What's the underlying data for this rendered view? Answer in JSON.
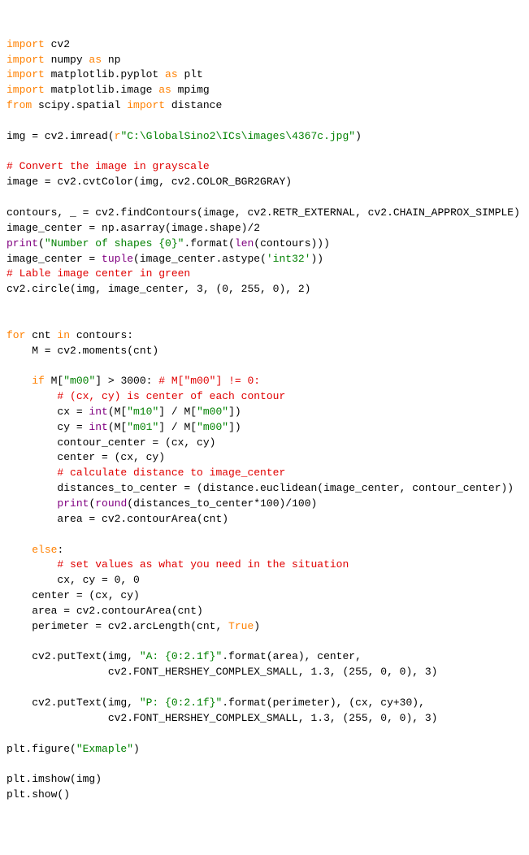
{
  "code": {
    "imports": [
      {
        "keyword": "import",
        "module": " cv2"
      },
      {
        "keyword": "import",
        "module": " numpy ",
        "as": "as",
        "alias": " np"
      },
      {
        "keyword": "import",
        "module": " matplotlib.pyplot ",
        "as": "as",
        "alias": " plt"
      },
      {
        "keyword": "import",
        "module": " matplotlib.image ",
        "as": "as",
        "alias": " mpimg"
      },
      {
        "keyword": "from",
        "module": " scipy.spatial ",
        "import": "import",
        "name": " distance"
      }
    ],
    "blank1": "",
    "imread_line": {
      "pre": "img = cv2.imread(",
      "r": "r",
      "path": "\"C:\\GlobalSino2\\ICs\\images\\4367c.jpg\"",
      "post": ")"
    },
    "blank2": "",
    "comment_gray": "# Convert the image in grayscale",
    "cvtcolor": "image = cv2.cvtColor(img, cv2.COLOR_BGR2GRAY)",
    "blank3": "",
    "findcontours": "contours, _ = cv2.findContours(image, cv2.RETR_EXTERNAL, cv2.CHAIN_APPROX_SIMPLE)",
    "imgcenter1": "image_center = np.asarray(image.shape)/2",
    "print_shapes": {
      "kw": "print",
      "open": "(",
      "str": "\"Number of shapes {0}\"",
      "rest": ".format(",
      "len": "len",
      "rest2": "(contours)))"
    },
    "imgcenter2": {
      "pre": "image_center = ",
      "tuple": "tuple",
      "mid": "(image_center.astype(",
      "str": "'int32'",
      "post": "))"
    },
    "comment_green": "# Lable image center in green",
    "circle": "cv2.circle(img, image_center, 3, (0, 255, 0), 2)",
    "blank4": "",
    "blank5": "",
    "for_line": {
      "kw": "for",
      "mid": " cnt ",
      "in": "in",
      "rest": " contours:"
    },
    "moments": "    M = cv2.moments(cnt)",
    "blank6": "",
    "if_line": {
      "ind": "    ",
      "kw": "if",
      "mid": " M[",
      "str": "\"m00\"",
      "rest": "] > 3000: ",
      "comment": "# M[\"m00\"] != 0:"
    },
    "comment_cxcy": "        # (cx, cy) is center of each contour",
    "cx_line": {
      "ind": "        cx = ",
      "int": "int",
      "mid": "(M[",
      "s1": "\"m10\"",
      "mid2": "] / M[",
      "s2": "\"m00\"",
      "end": "])"
    },
    "cy_line": {
      "ind": "        cy = ",
      "int": "int",
      "mid": "(M[",
      "s1": "\"m01\"",
      "mid2": "] / M[",
      "s2": "\"m00\"",
      "end": "])"
    },
    "contour_center": "        contour_center = (cx, cy)",
    "center1": "        center = (cx, cy)",
    "comment_dist": "        # calculate distance to image_center",
    "dist_line": "        distances_to_center = (distance.euclidean(image_center, contour_center))",
    "print_dist": {
      "ind": "        ",
      "kw": "print",
      "open": "(",
      "round": "round",
      "rest": "(distances_to_center*100)/100)"
    },
    "area1": "        area = cv2.contourArea(cnt)",
    "blank7": "",
    "else_line": {
      "ind": "    ",
      "kw": "else",
      "colon": ":"
    },
    "comment_else": "        # set values as what you need in the situation",
    "cxcy0": "        cx, cy = 0, 0",
    "center2": "    center = (cx, cy)",
    "area2": "    area = cv2.contourArea(cnt)",
    "perimeter": {
      "pre": "    perimeter = cv2.arcLength(cnt, ",
      "true": "True",
      "post": ")"
    },
    "blank8": "",
    "puttext1a": {
      "pre": "    cv2.putText(img, ",
      "str": "\"A: {0:2.1f}\"",
      "rest": ".format(area), center,"
    },
    "puttext1b": "                cv2.FONT_HERSHEY_COMPLEX_SMALL, 1.3, (255, 0, 0), 3)",
    "blank9": "",
    "puttext2a": {
      "pre": "    cv2.putText(img, ",
      "str": "\"P: {0:2.1f}\"",
      "rest": ".format(perimeter), (cx, cy+30),"
    },
    "puttext2b": "                cv2.FONT_HERSHEY_COMPLEX_SMALL, 1.3, (255, 0, 0), 3)",
    "blank10": "",
    "figure": {
      "pre": "plt.figure(",
      "str": "\"Exmaple\"",
      "post": ")"
    },
    "blank11": "",
    "imshow": "plt.imshow(img)",
    "show": "plt.show()"
  }
}
